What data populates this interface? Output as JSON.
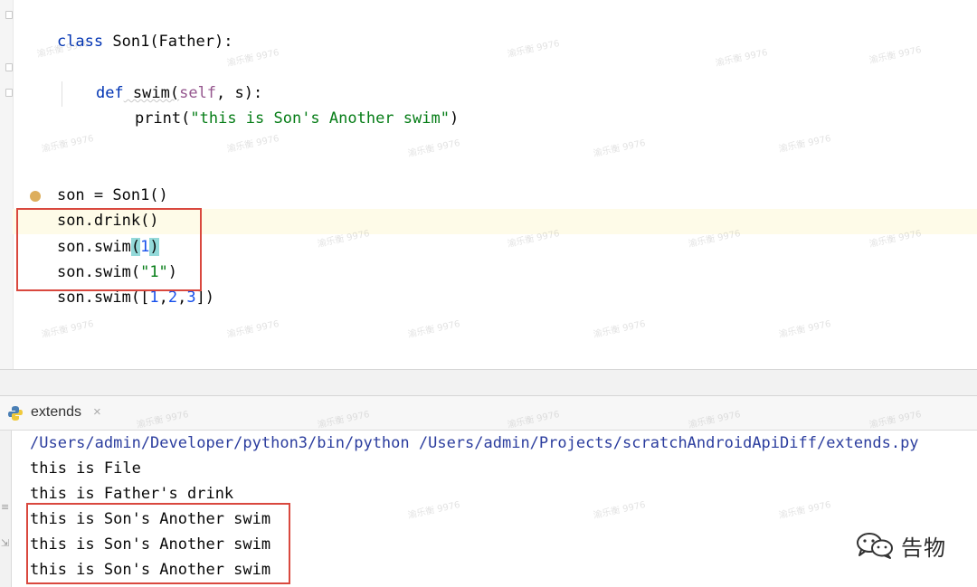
{
  "editor": {
    "code_lines": [
      {
        "id": "l1",
        "text_a": "class",
        "text_b": " Son1(Father):"
      },
      {
        "id": "l2",
        "def": "def",
        "name": " swim(",
        "self": "self",
        "rest": ", s):"
      },
      {
        "id": "l3",
        "fn": "print(",
        "str": "\"this is Son's Another swim\"",
        "end": ")"
      },
      {
        "id": "l4",
        "text": "son = Son1()"
      },
      {
        "id": "l5",
        "text": "son.drink()"
      },
      {
        "id": "l6",
        "pre": "son.swim",
        "open": "(",
        "num": "1",
        "close": ")"
      },
      {
        "id": "l7",
        "pre": "son.swim(",
        "str": "\"1\"",
        "end": ")"
      },
      {
        "id": "l8",
        "pre": "son.swim([",
        "n1": "1",
        "c1": ",",
        "n2": "2",
        "c2": ",",
        "n3": "3",
        "end": "])"
      }
    ]
  },
  "run_panel": {
    "tab_label": "extends",
    "close_glyph": "×",
    "console_lines": [
      "/Users/admin/Developer/python3/bin/python /Users/admin/Projects/scratchAndroidApiDiff/extends.py",
      "this is File",
      "this is Father's drink",
      "this is Son's Another swim",
      "this is Son's Another swim",
      "this is Son's Another swim"
    ]
  },
  "watermark_text": "渝乐衡 9976",
  "branding": {
    "label": "告物",
    "icon": "wechat-icon"
  },
  "colors": {
    "keyword": "#0033b3",
    "string": "#067d17",
    "number": "#1750eb",
    "self": "#94558d",
    "highlight_box": "#d9483e",
    "console_path": "#2b3d9e"
  }
}
